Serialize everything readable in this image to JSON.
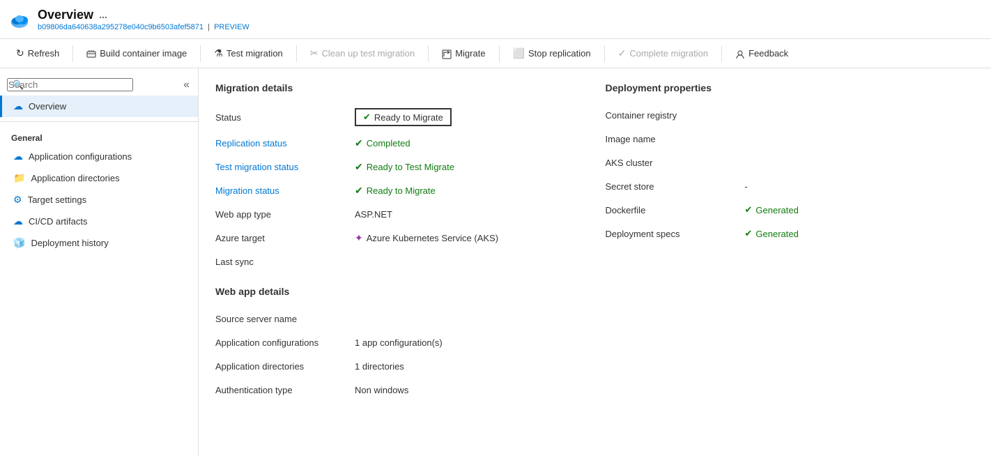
{
  "header": {
    "title": "Overview",
    "ellipsis": "...",
    "subtitle_id": "b09806da640638a295278e040c9b6503afef5871",
    "subtitle_preview": "PREVIEW"
  },
  "toolbar": {
    "buttons": [
      {
        "id": "refresh",
        "label": "Refresh",
        "icon": "↻",
        "disabled": false
      },
      {
        "id": "build-container-image",
        "label": "Build container image",
        "icon": "🏗",
        "disabled": false
      },
      {
        "id": "test-migration",
        "label": "Test migration",
        "icon": "🧪",
        "disabled": false
      },
      {
        "id": "clean-up-test-migration",
        "label": "Clean up test migration",
        "icon": "✂",
        "disabled": true
      },
      {
        "id": "migrate",
        "label": "Migrate",
        "icon": "⬆",
        "disabled": false
      },
      {
        "id": "stop-replication",
        "label": "Stop replication",
        "icon": "⬜",
        "disabled": false
      },
      {
        "id": "complete-migration",
        "label": "Complete migration",
        "icon": "✓",
        "disabled": true
      },
      {
        "id": "feedback",
        "label": "Feedback",
        "icon": "👤",
        "disabled": false
      }
    ]
  },
  "sidebar": {
    "search_placeholder": "Search",
    "nav_items": [
      {
        "id": "overview",
        "label": "Overview",
        "icon": "☁",
        "active": true,
        "section": null
      },
      {
        "id": "general-label",
        "label": "General",
        "section_header": true
      },
      {
        "id": "app-configurations",
        "label": "Application configurations",
        "icon": "☁",
        "active": false
      },
      {
        "id": "app-directories",
        "label": "Application directories",
        "icon": "📁",
        "active": false
      },
      {
        "id": "target-settings",
        "label": "Target settings",
        "icon": "⚙",
        "active": false
      },
      {
        "id": "cicd-artifacts",
        "label": "CI/CD artifacts",
        "icon": "☁",
        "active": false
      },
      {
        "id": "deployment-history",
        "label": "Deployment history",
        "icon": "🧊",
        "active": false
      }
    ]
  },
  "content": {
    "migration_details_title": "Migration details",
    "deployment_properties_title": "Deployment properties",
    "migration_rows": [
      {
        "label": "Status",
        "value": "Ready to Migrate",
        "type": "status-box",
        "icon": "✔"
      },
      {
        "label": "Replication status",
        "value": "Completed",
        "type": "green",
        "icon": "✔",
        "link": true
      },
      {
        "label": "Test migration status",
        "value": "Ready to Test Migrate",
        "type": "green",
        "icon": "✔",
        "link": true
      },
      {
        "label": "Migration status",
        "value": "Ready to Migrate",
        "type": "green",
        "icon": "✔",
        "link": true
      },
      {
        "label": "Web app type",
        "value": "ASP.NET",
        "type": "plain",
        "icon": ""
      },
      {
        "label": "Azure target",
        "value": "Azure Kubernetes Service (AKS)",
        "type": "aks",
        "icon": "✦"
      },
      {
        "label": "Last sync",
        "value": "",
        "type": "plain",
        "icon": ""
      }
    ],
    "deployment_rows": [
      {
        "label": "Container registry",
        "value": "",
        "type": "plain",
        "icon": ""
      },
      {
        "label": "Image name",
        "value": "",
        "type": "plain",
        "icon": ""
      },
      {
        "label": "AKS cluster",
        "value": "",
        "type": "plain",
        "icon": ""
      },
      {
        "label": "Secret store",
        "value": "-",
        "type": "plain",
        "icon": ""
      },
      {
        "label": "Dockerfile",
        "value": "Generated",
        "type": "green",
        "icon": "✔"
      },
      {
        "label": "Deployment specs",
        "value": "Generated",
        "type": "green",
        "icon": "✔"
      }
    ],
    "web_app_details_title": "Web app details",
    "web_app_rows": [
      {
        "label": "Source server name",
        "value": "",
        "type": "plain"
      },
      {
        "label": "Application configurations",
        "value": "1 app configuration(s)",
        "type": "plain"
      },
      {
        "label": "Application directories",
        "value": "1 directories",
        "type": "plain"
      },
      {
        "label": "Authentication type",
        "value": "Non windows",
        "type": "plain"
      }
    ]
  }
}
